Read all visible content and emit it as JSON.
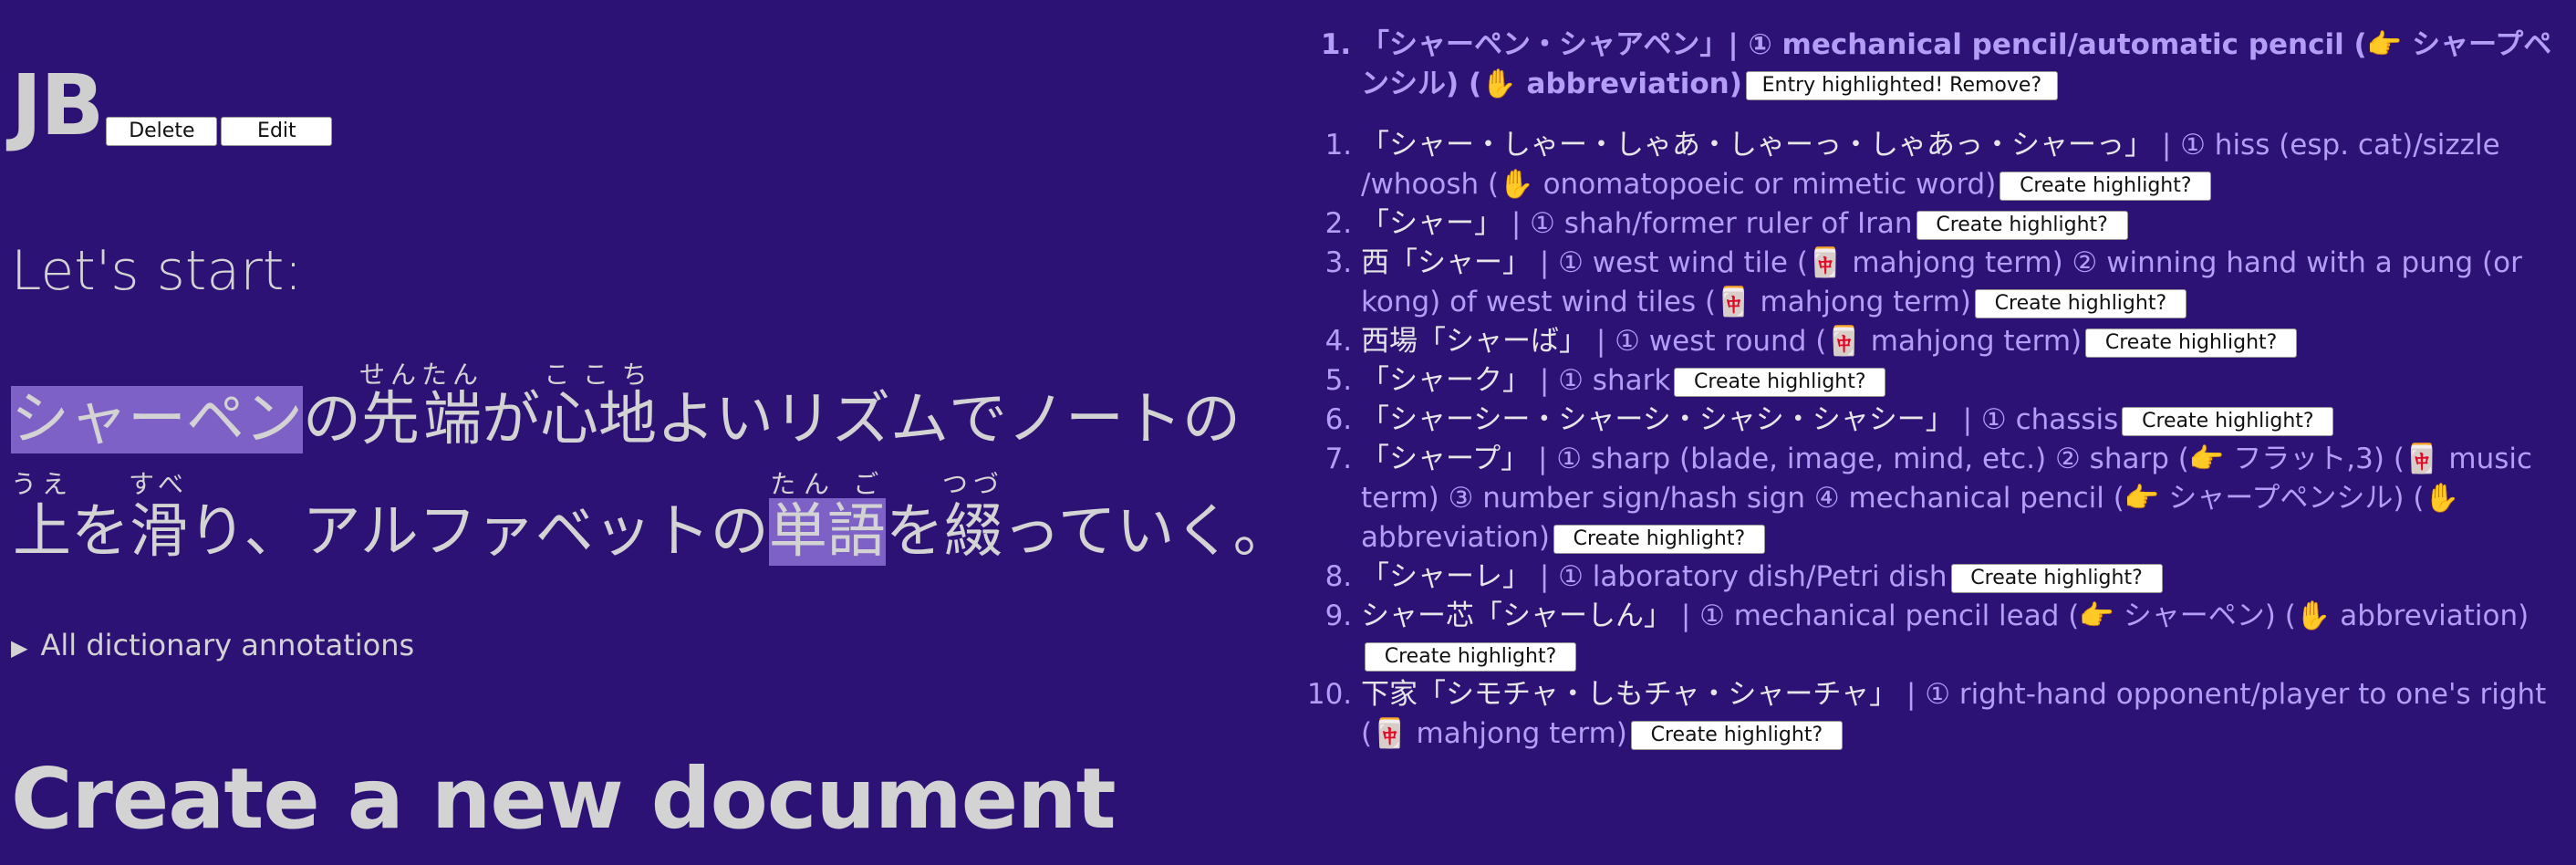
{
  "document": {
    "title": "JB",
    "delete_label": "Delete",
    "edit_label": "Edit",
    "intro": "Let's start:",
    "details_summary": "All dictionary annotations",
    "create_heading": "Create a new document",
    "line1": {
      "hl_word": "シャーペン",
      "no": "の",
      "sentan": "先端",
      "sentan_rt": "せんたん",
      "ga": "が",
      "kokochi": "心地",
      "kokochi_rt": "ここち",
      "rest": "よいリズムでノートの"
    },
    "line2": {
      "ue": "上",
      "ue_rt": "うえ",
      "wo": "を",
      "sube": "滑",
      "sube_rt": "すべ",
      "mid": "り、アルファベットの",
      "tango": "単語",
      "tango_rt": "たん ご",
      "wo2": "を",
      "tsuzu": "綴",
      "tsuzu_rt": "つづ",
      "end": "っていく。"
    }
  },
  "highlighted": {
    "entry": "「シャーペン・シャアペン」| ① mechanical pencil/automatic pencil (👉 シャープペンシル) (✋ abbreviation)",
    "remove_label": "Entry highlighted! Remove?"
  },
  "dictionary": {
    "create_label": "Create highlight?",
    "entries": [
      {
        "num": "1.",
        "kana": "「シャー・しゃー・しゃあ・しゃーっ・しゃあっ・シャーっ」",
        "def": " | ① hiss (esp. cat)/sizzle /whoosh (✋ onomatopoeic or mimetic word)"
      },
      {
        "num": "2.",
        "kana": "「シャー」",
        "def": " | ① shah/former ruler of Iran"
      },
      {
        "num": "3.",
        "kana": "西「シャー」",
        "def": " | ① west wind tile (🀄 mahjong term) ② winning hand with a pung (or kong) of west wind tiles (🀄 mahjong term)"
      },
      {
        "num": "4.",
        "kana": "西場「シャーば」",
        "def": " | ① west round (🀄 mahjong term)"
      },
      {
        "num": "5.",
        "kana": "「シャーク」",
        "def": " | ① shark"
      },
      {
        "num": "6.",
        "kana": "「シャーシー・シャーシ・シャシ・シャシー」",
        "def": " | ① chassis"
      },
      {
        "num": "7.",
        "kana": "「シャープ」",
        "def": " | ① sharp (blade, image, mind, etc.) ② sharp (👉 フラット,3) (🀄 music term) ③ number sign/hash sign ④ mechanical pencil (👉 シャープペンシル) (✋ abbreviation)"
      },
      {
        "num": "8.",
        "kana": "「シャーレ」",
        "def": " | ① laboratory dish/Petri dish"
      },
      {
        "num": "9.",
        "kana": "シャー芯「シャーしん」",
        "def": " | ① mechanical pencil lead (👉 シャーペン) (✋ abbreviation)"
      },
      {
        "num": "10.",
        "kana": "下家「シモチャ・しもチャ・シャーチャ」",
        "def": " | ① right-hand opponent/player to one's right (🀄 mahjong term)"
      }
    ]
  }
}
